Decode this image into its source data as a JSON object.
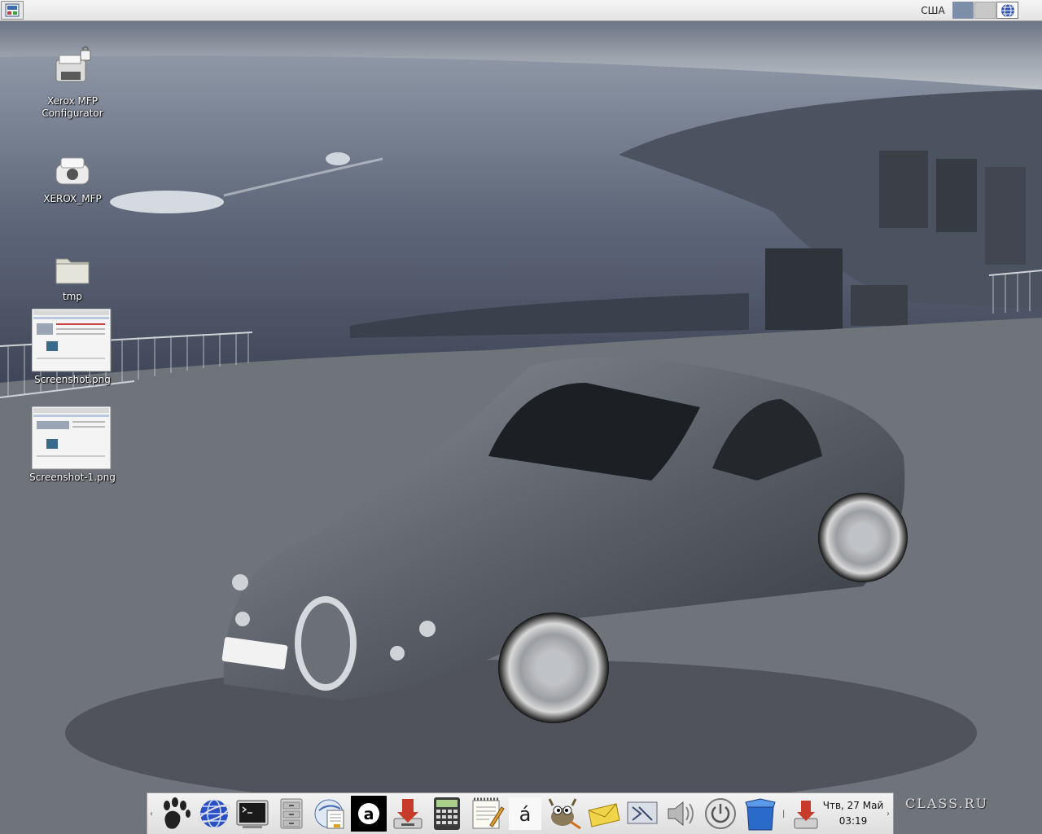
{
  "top_panel": {
    "keyboard_layout": "США",
    "pager_workspaces": 2,
    "accent_color": "#7d8ea8"
  },
  "desktop_icons": [
    {
      "label": "Xerox MFP\nConfigurator",
      "icon": "printer-lock-icon"
    },
    {
      "label": "XEROX_MFP",
      "icon": "printer-icon"
    },
    {
      "label": "tmp",
      "icon": "folder-icon"
    },
    {
      "label": "Screenshot.png",
      "icon": "image-thumbnail"
    },
    {
      "label": "Screenshot-1.png",
      "icon": "image-thumbnail"
    }
  ],
  "dock": {
    "launchers": [
      "gnome-foot-icon",
      "web-browser-globe-icon",
      "terminal-icon",
      "file-cabinet-icon",
      "mail-client-icon",
      "adobe-reader-icon",
      "download-manager-icon",
      "calculator-icon",
      "text-editor-icon",
      "character-map-icon",
      "gimp-icon",
      "mail-envelope-icon",
      "remote-desktop-icon",
      "volume-icon",
      "power-icon",
      "software-installer-icon",
      "update-manager-icon"
    ],
    "clock_date": "Чтв, 27 Май",
    "clock_time": "03:19"
  },
  "watermark": "CLASS.RU"
}
